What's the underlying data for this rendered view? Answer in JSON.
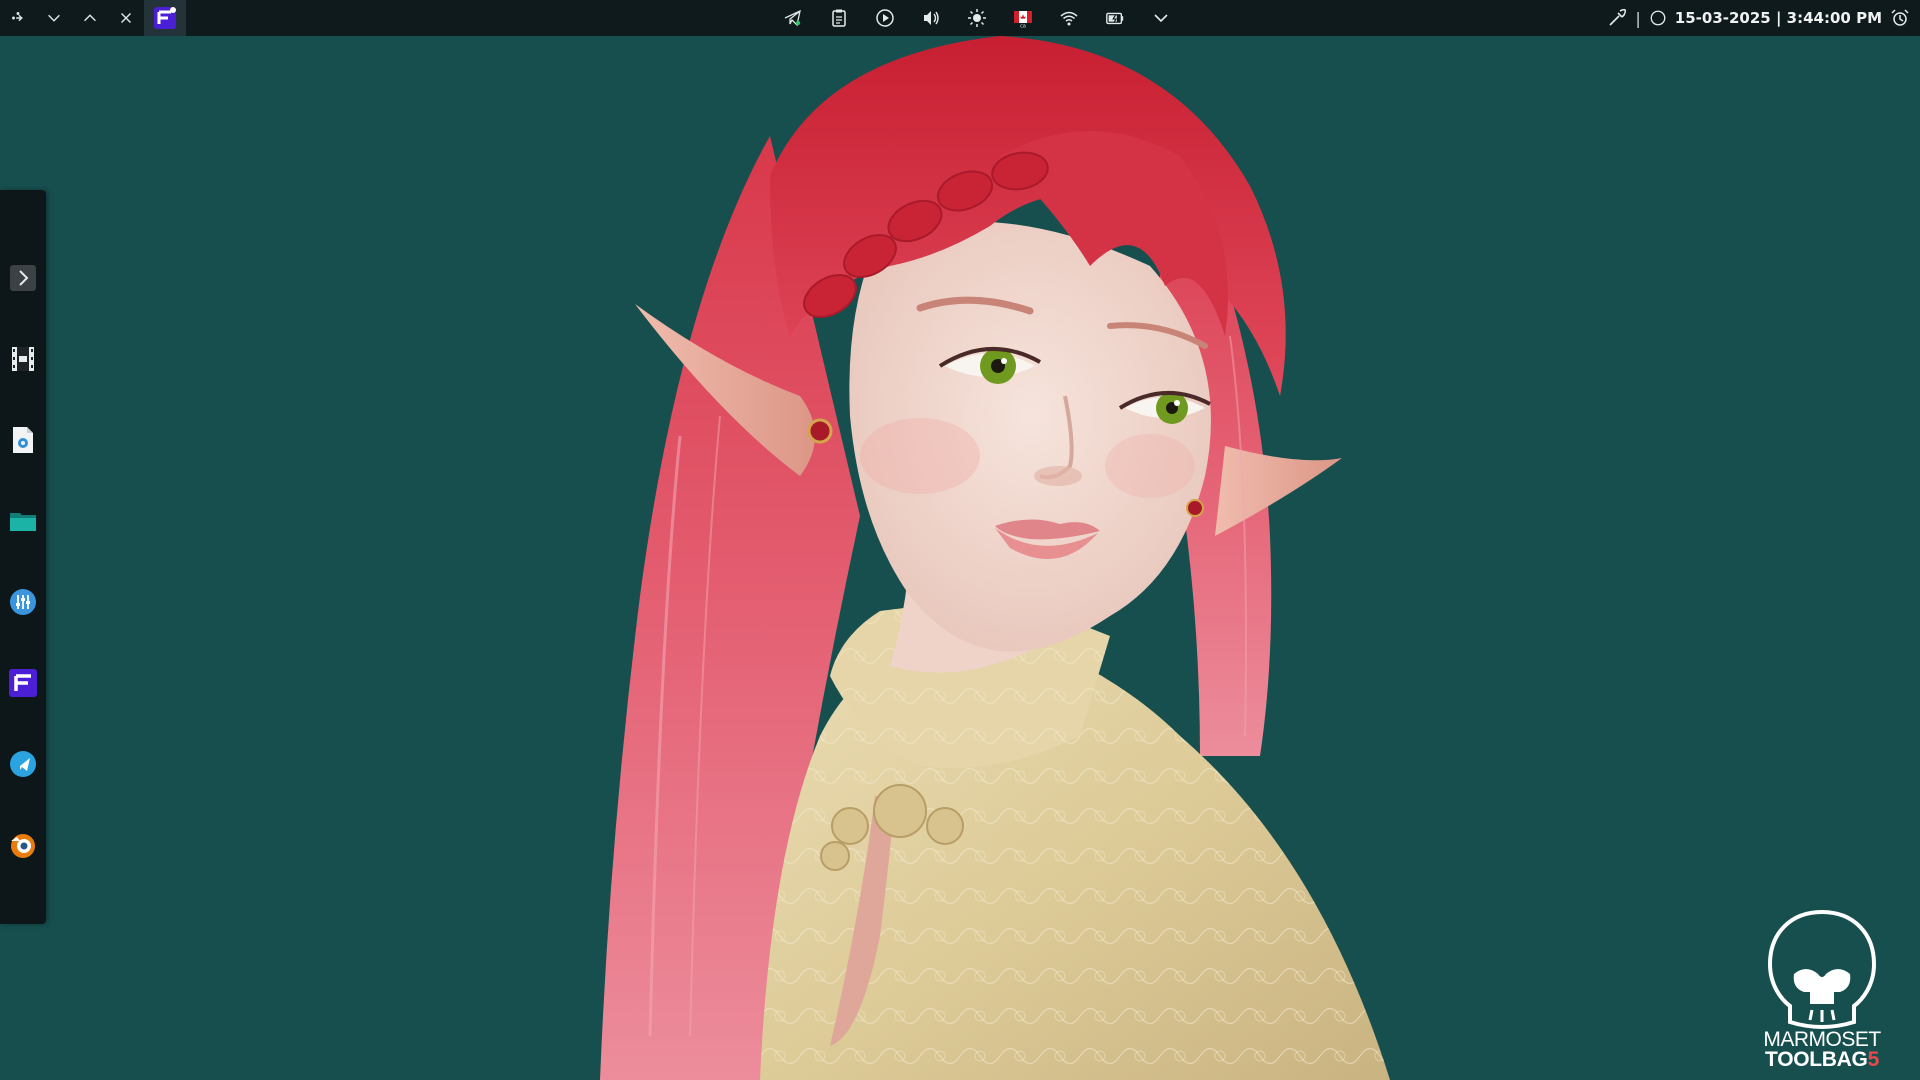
{
  "topbar": {
    "left_buttons": [
      {
        "name": "menu-icon"
      },
      {
        "name": "minimize-icon"
      },
      {
        "name": "maximize-icon"
      },
      {
        "name": "close-icon"
      }
    ],
    "active_task_icon": "fusion-app-icon",
    "tray_icons": [
      "telegram-tray-icon",
      "clipboard-icon",
      "media-player-icon",
      "volume-icon",
      "brightness-icon",
      "keyboard-layout-icon",
      "wifi-icon",
      "battery-icon",
      "chevron-down-icon"
    ],
    "keyboard_layout_label": "ca",
    "clock": "15-03-2025 | 3:44:00 PM",
    "separator": "|"
  },
  "dock": {
    "items": [
      {
        "name": "expand-dock-icon"
      },
      {
        "name": "film-editor-icon"
      },
      {
        "name": "document-settings-icon"
      },
      {
        "name": "file-manager-icon"
      },
      {
        "name": "mixer-icon"
      },
      {
        "name": "fusion-app-icon"
      },
      {
        "name": "telegram-icon"
      },
      {
        "name": "blender-icon"
      }
    ]
  },
  "logo": {
    "line1": "MARMOSET",
    "line2_text": "TOOLBAG",
    "line2_number": "5"
  },
  "colors": {
    "background": "#174f4f",
    "panel": "#0e1a1c",
    "hair": "#d8384a",
    "hair_long": "#e6778a",
    "skin": "#efd5cc",
    "dress": "#e2d2a4",
    "logo_accent": "#e84a4a"
  }
}
